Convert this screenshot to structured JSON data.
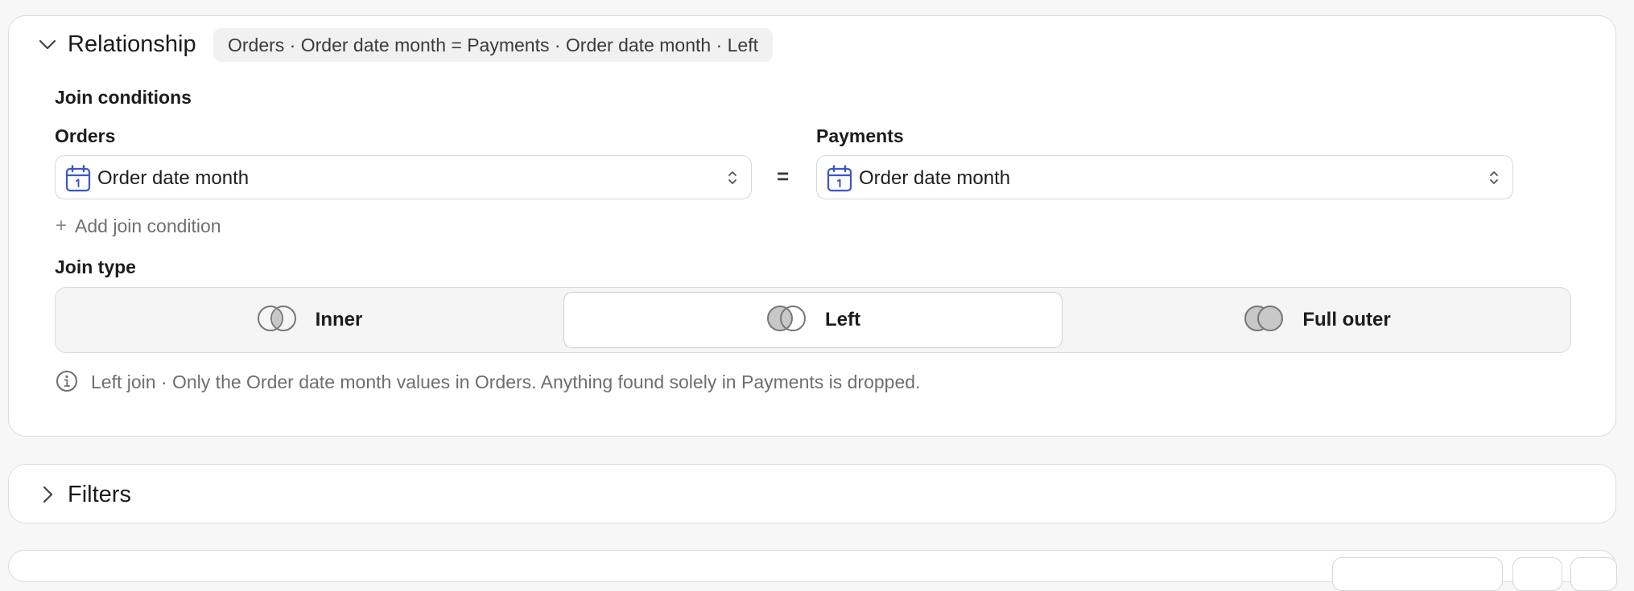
{
  "relationship": {
    "title": "Relationship",
    "summary": "Orders · Order date month = Payments · Order date month · Left",
    "join_conditions_label": "Join conditions",
    "left_table": "Orders",
    "right_table": "Payments",
    "left_field": "Order date month",
    "right_field": "Order date month",
    "operator": "=",
    "add_condition_label": "Add join condition",
    "join_type_label": "Join type",
    "join_types": [
      {
        "label": "Inner",
        "selected": false
      },
      {
        "label": "Left",
        "selected": true
      },
      {
        "label": "Full outer",
        "selected": false
      }
    ],
    "info_text": "Left join · Only the Order date month values in Orders. Anything found solely in Payments is dropped."
  },
  "filters": {
    "title": "Filters"
  },
  "icons": {
    "collapse": "chevron-down-icon",
    "expand": "chevron-right-icon",
    "field_type": "calendar-icon",
    "select_toggle": "chevron-updown-icon",
    "add": "plus-icon",
    "join": "venn-icon",
    "info": "info-icon"
  },
  "colors": {
    "calendar_icon": "#3b55c9",
    "venn_fill": "#c8c8c8",
    "muted_text": "#6e6e6e"
  }
}
